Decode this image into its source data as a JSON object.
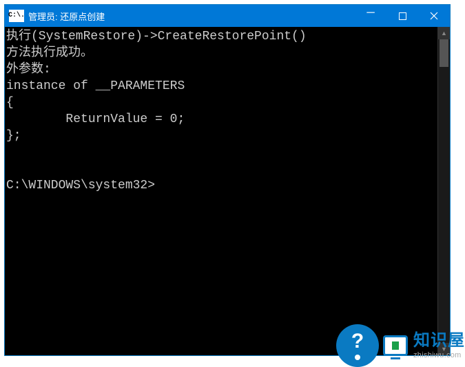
{
  "window": {
    "icon_text": "C:\\.",
    "title": "管理员: 还原点创建"
  },
  "terminal": {
    "lines": [
      "执行(SystemRestore)->CreateRestorePoint()",
      "方法执行成功。",
      "外参数:",
      "instance of __PARAMETERS",
      "{",
      "        ReturnValue = 0;",
      "};",
      "",
      "",
      "C:\\WINDOWS\\system32>"
    ]
  },
  "watermark": {
    "title_cn": "知识屋",
    "title_en": "zhishiwu.com"
  }
}
